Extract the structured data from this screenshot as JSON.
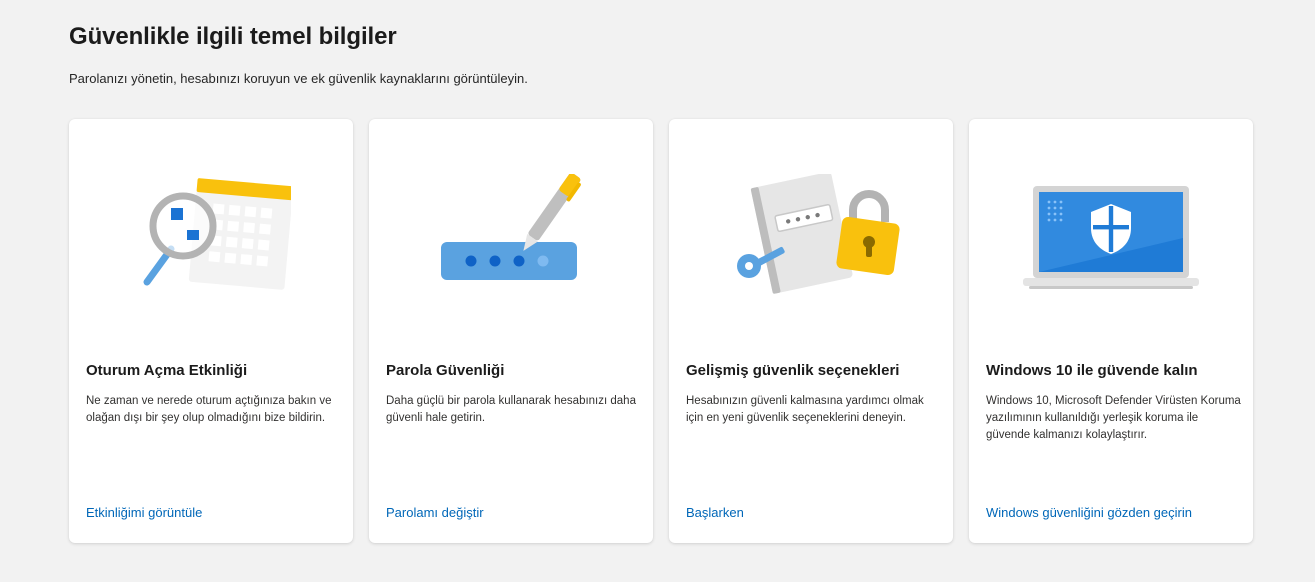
{
  "page": {
    "title": "Güvenlikle ilgili temel bilgiler",
    "subtitle": "Parolanızı yönetin, hesabınızı koruyun ve ek güvenlik kaynaklarını görüntüleyin."
  },
  "colors": {
    "background": "#f2f2f2",
    "card": "#ffffff",
    "link": "#0067b8",
    "accent_blue": "#2a7ad6",
    "accent_yellow": "#f9c10d"
  },
  "cards": [
    {
      "icon": "magnifier-calendar-icon",
      "title": "Oturum Açma Etkinliği",
      "description": "Ne zaman ve nerede oturum açtığınıza bakın ve olağan dışı bir şey olup olmadığını bize bildirin.",
      "link": "Etkinliğimi görüntüle"
    },
    {
      "icon": "password-pen-icon",
      "title": "Parola Güvenliği",
      "description": "Daha güçlü bir parola kullanarak hesabınızı daha güvenli hale getirin.",
      "link": "Parolamı değiştir"
    },
    {
      "icon": "lock-key-notebook-icon",
      "title": "Gelişmiş güvenlik seçenekleri",
      "description": "Hesabınızın güvenli kalmasına yardımcı olmak için en yeni güvenlik seçeneklerini deneyin.",
      "link": "Başlarken"
    },
    {
      "icon": "laptop-shield-icon",
      "title": "Windows 10 ile güvende kalın",
      "description": "Windows 10, Microsoft Defender Virüsten Koruma yazılımının kullanıldığı yerleşik koruma ile güvende kalmanızı kolaylaştırır.",
      "link": "Windows güvenliğini gözden geçirin"
    }
  ]
}
